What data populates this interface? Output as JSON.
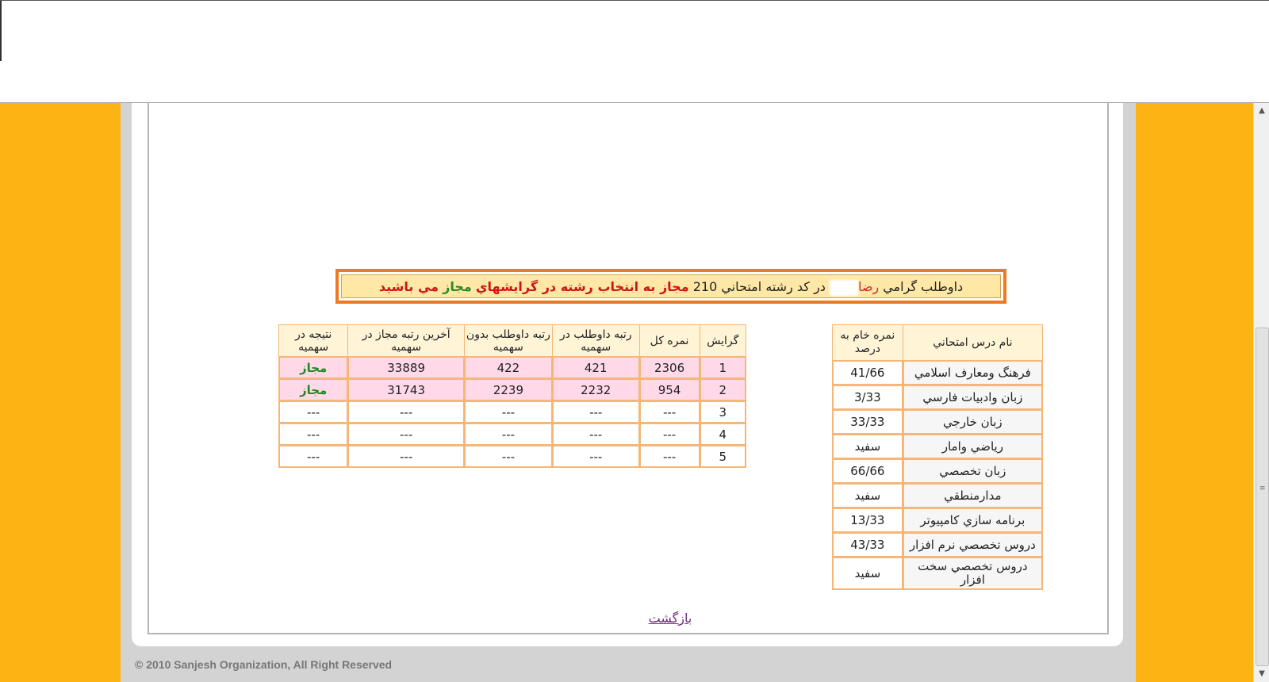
{
  "banner": {
    "part1": "داوطلب گرامي",
    "name": "رضا",
    "part2": "در کد رشته امتحاني",
    "code": "210",
    "red1": "مجاز به انتخاب رشته در گرايشهاي",
    "green": "مجاز",
    "red2": "مي باشيد"
  },
  "results": {
    "headers": [
      "گرايش",
      "نمره کل",
      "رتبه داوطلب در سهميه",
      "رتبه داوطلب بدون سهميه",
      "آخرين رتبه مجاز در سهميه",
      "نتيجه در سهميه"
    ],
    "rows": [
      [
        "1",
        "2306",
        "421",
        "422",
        "33889",
        "مجاز"
      ],
      [
        "2",
        "954",
        "2232",
        "2239",
        "31743",
        "مجاز"
      ],
      [
        "3",
        "---",
        "---",
        "---",
        "---",
        "---"
      ],
      [
        "4",
        "---",
        "---",
        "---",
        "---",
        "---"
      ],
      [
        "5",
        "---",
        "---",
        "---",
        "---",
        "---"
      ]
    ]
  },
  "grades": {
    "headers": [
      "نام درس امتحاني",
      "نمره خام به درصد"
    ],
    "rows": [
      [
        "فرهنگ ومعارف اسلامي",
        "41/66"
      ],
      [
        "زبان وادبيات فارسي",
        "3/33"
      ],
      [
        "زبان خارجي",
        "33/33"
      ],
      [
        "رياضي وامار",
        "سفيد"
      ],
      [
        "زبان تخصصي",
        "66/66"
      ],
      [
        "مدارمنطقي",
        "سفيد"
      ],
      [
        "برنامه سازي کامپيوتر",
        "13/33"
      ],
      [
        "دروس تخصصي نرم افزار",
        "43/33"
      ],
      [
        "دروس تخصصي سخت افزار",
        "سفيد"
      ]
    ]
  },
  "back_link": "بازگشت",
  "footer": "© 2010 Sanjesh Organization, All Right Reserved",
  "colors": {
    "side": "#fcb414",
    "banner_border": "#f0781e",
    "banner_bg": "#ffe7a6",
    "pink_row": "#ffd9e8",
    "ok_green": "#1f8a1f"
  },
  "icons": {
    "scroll_up": "arrow-up-icon",
    "scroll_down": "arrow-down-icon"
  }
}
